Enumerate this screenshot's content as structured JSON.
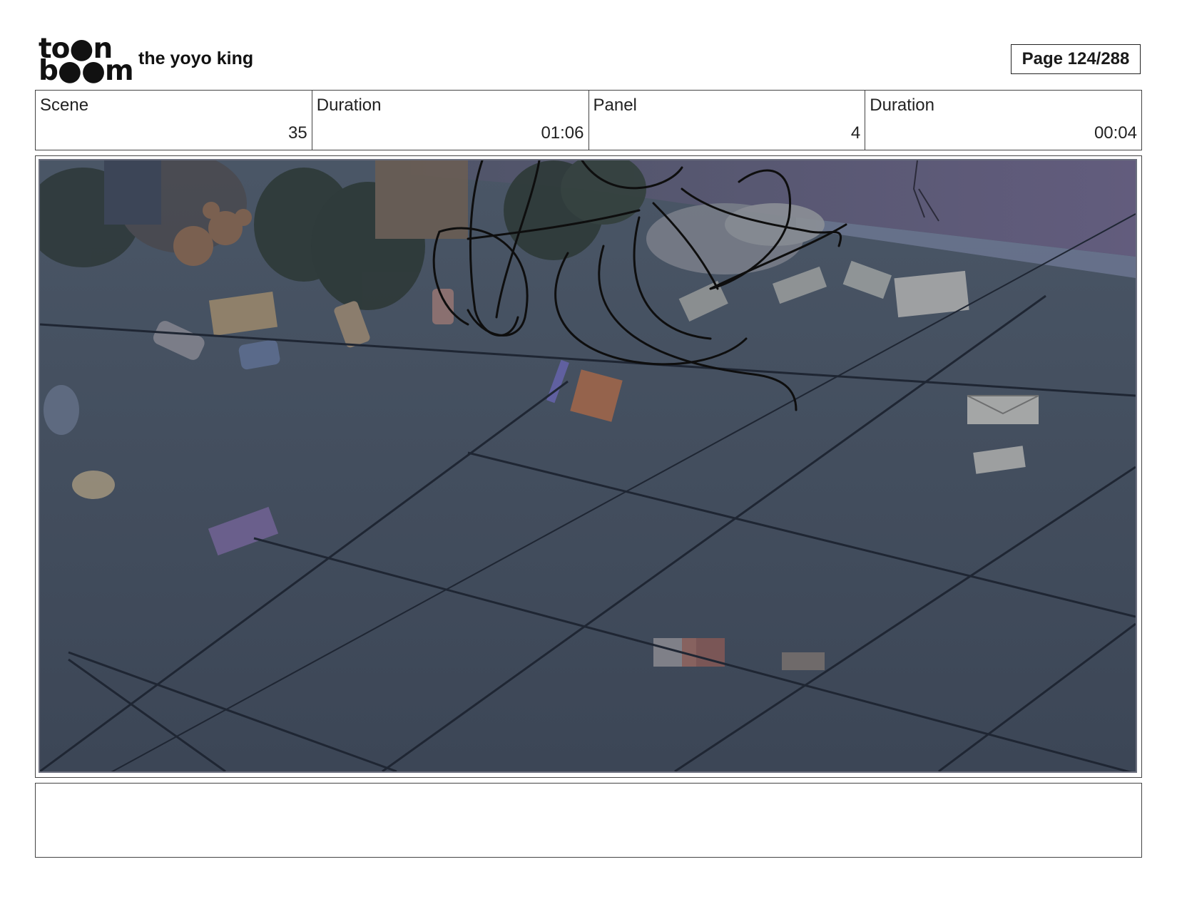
{
  "header": {
    "logo_line1": "to●n",
    "logo_line2": "b●●m",
    "project_title": "the yoyo king",
    "page_label": "Page 124/288"
  },
  "info": {
    "scene_label": "Scene",
    "scene_value": "35",
    "scene_duration_label": "Duration",
    "scene_duration_value": "01:06",
    "panel_label": "Panel",
    "panel_value": "4",
    "panel_duration_label": "Duration",
    "panel_duration_value": "00:04"
  },
  "panel": {
    "floor_color": "#3f4a58",
    "wall_color": "#5b5775",
    "trash_color": "#2f3a3a",
    "sketch_color": "#111111"
  },
  "notes": {
    "text": ""
  }
}
